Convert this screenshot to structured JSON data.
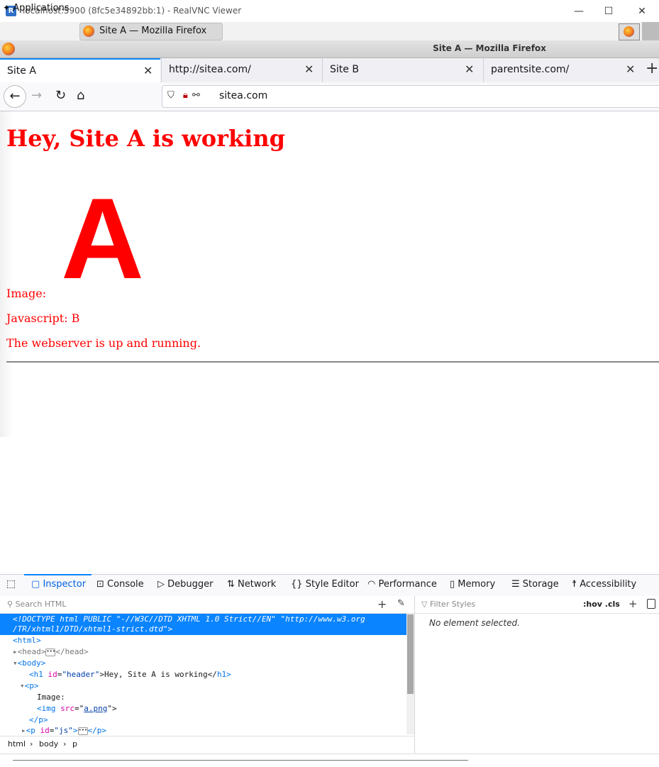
{
  "vnc": {
    "title": "localhost:5900 (8fc5e34892bb:1) - RealVNC Viewer",
    "logo": "R",
    "minimize": "—",
    "maximize": "☐",
    "close": "✕"
  },
  "panel": {
    "applications": "Applications",
    "task_title": "Site A — Mozilla Firefox"
  },
  "firefox": {
    "window_title": "Site A — Mozilla Firefox",
    "tabs": [
      {
        "label": "Site A",
        "active": true
      },
      {
        "label": "http://sitea.com/"
      },
      {
        "label": "Site B"
      },
      {
        "label": "parentsite.com/"
      }
    ],
    "tab_close": "✕",
    "new_tab": "+",
    "url": "sitea.com",
    "icons": [
      "back-arrow-icon",
      "forward-arrow-icon",
      "reload-icon",
      "home-icon",
      "shield-icon",
      "insecure-lock-icon",
      "permissions-icon"
    ]
  },
  "page": {
    "heading": "Hey, Site A is working",
    "image_letter": "A",
    "image_label": "Image:",
    "javascript": "Javascript: B",
    "status": "The webserver is up and running."
  },
  "devtools": {
    "tabs": [
      "Inspector",
      "Console",
      "Debugger",
      "Network",
      "Style Editor",
      "Performance",
      "Memory",
      "Storage",
      "Accessibility"
    ],
    "search_placeholder": "Search HTML",
    "filter_placeholder": "Filter Styles",
    "hov_cls": ":hov .cls",
    "no_element": "No element selected.",
    "markup": {
      "doctype_1": "<!DOCTYPE html PUBLIC \"-//W3C//DTD XHTML 1.0 Strict//EN\" \"http://www.w3.org",
      "doctype_2": "/TR/xhtml1/DTD/xhtml1-strict.dtd\">",
      "html_open": "<html>",
      "head_open": "<head>",
      "head_close": "</head>",
      "body_open": "<body>",
      "h1_tag_open": "<h1",
      "h1_attr": "id",
      "h1_val": "\"header\"",
      "h1_text": ">Hey, Site A is working</",
      "h1_tag_close": "h1>",
      "p_open": "<p>",
      "p_text": "Image:",
      "img_tag": "<img",
      "img_attr": "src",
      "img_val": "a.png",
      "img_close": "\">",
      "p_close": "</p>",
      "p2_tag": "<p",
      "p2_attr": "id",
      "p2_val": "\"js\"",
      "p2_close": "</p>"
    },
    "breadcrumbs": [
      "html",
      "body",
      "p"
    ]
  },
  "colors": {
    "page_text": "#ff0000",
    "accent": "#0a84ff",
    "selected_row": "#0a84ff"
  }
}
